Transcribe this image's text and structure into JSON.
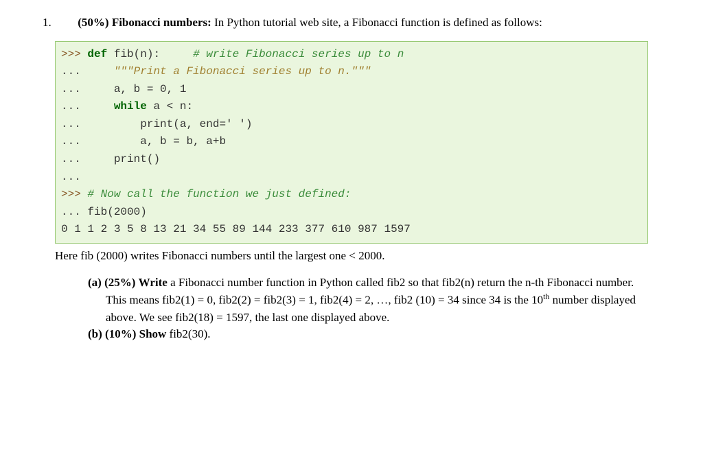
{
  "question": {
    "number": "1.",
    "weight": "(50%)",
    "title": "Fibonacci numbers:",
    "intro": " In Python tutorial web site, a Fibonacci function is defined as follows:"
  },
  "code": {
    "p": ">>>",
    "d": "...",
    "def": "def",
    "fib_sig": " fib(n):",
    "c1": "# write Fibonacci series up to n",
    "doc": "\"\"\"Print a Fibonacci series up to n.\"\"\"",
    "l_assign1": "a, b = 0, 1",
    "while": "while",
    "while_tail": " a < n:",
    "l_print": "print(a, end=' ')",
    "l_assign2": "a, b = b, a+b",
    "l_print2": "print()",
    "c2": "# Now call the function we just defined:",
    "call": " fib(2000)",
    "output": "0 1 1 2 3 5 8 13 21 34 55 89 144 233 377 610 987 1597"
  },
  "after_code": "Here fib (2000) writes Fibonacci numbers until the largest one < 2000.",
  "parts": {
    "a_label": "(a)",
    "a_weight": "(25%)",
    "a_verb": " Write",
    "a_text1": " a Fibonacci number function in Python called fib2 so that fib2(n) return the n-th Fibonacci number. This means fib2(1) = 0, fib2(2) = fib2(3) = 1, fib2(4) = 2, …, fib2 (10) = 34 since 34 is the 10",
    "a_sup": "th",
    "a_text2": " number displayed above. We see fib2(18) = 1597, the last one displayed above.",
    "b_label": "(b)",
    "b_weight": "(10%)",
    "b_verb": " Show",
    "b_text": " fib2(30)."
  }
}
